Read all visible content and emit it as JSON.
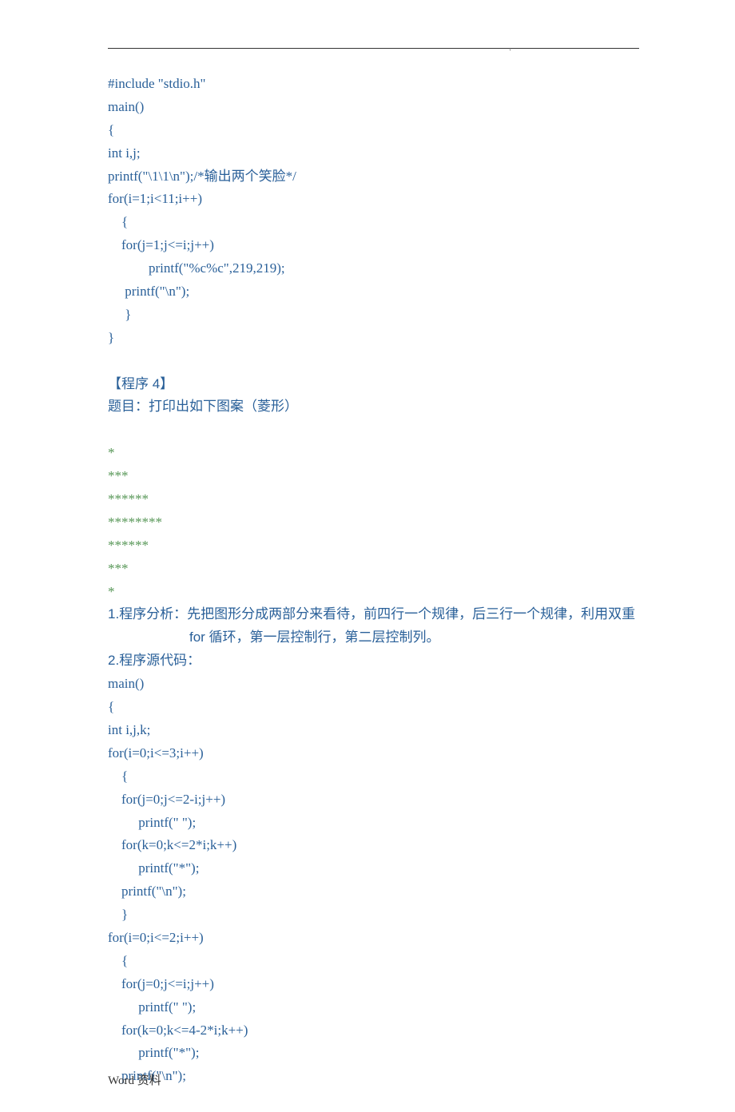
{
  "dot": ".",
  "code1": {
    "l1": "#include \"stdio.h\"",
    "l2": "main()",
    "l3": "{",
    "l4": "int i,j;",
    "l5": "printf(\"\\1\\1\\n\");/*输出两个笑脸*/",
    "l6": "for(i=1;i<11;i++)",
    "l7": "　{",
    "l8": "　for(j=1;j<=i;j++)",
    "l9": "　　　printf(\"%c%c\",219,219);",
    "l10": "　 printf(\"\\n\");",
    "l11": "　 }",
    "l12": "}"
  },
  "heading4": "【程序 4】",
  "title4": "题目：打印出如下图案（菱形）",
  "pattern": {
    "l1": "*",
    "l2": "***",
    "l3": "******",
    "l4": "********",
    "l5": "******",
    "l6": "***",
    "l7": "*"
  },
  "analysis": {
    "l1": "1.程序分析：先把图形分成两部分来看待，前四行一个规律，后三行一个规律，利用双重",
    "l2": "　　　　　　for 循环，第一层控制行，第二层控制列。",
    "l3": "2.程序源代码："
  },
  "code2": {
    "l1": "main()",
    "l2": "{",
    "l3": "int i,j,k;",
    "l4": "for(i=0;i<=3;i++)",
    "l5": "　{",
    "l6": "　for(j=0;j<=2-i;j++)",
    "l7": "　　 printf(\" \");",
    "l8": "　for(k=0;k<=2*i;k++)",
    "l9": "　　 printf(\"*\");",
    "l10": "　printf(\"\\n\");",
    "l11": "　}",
    "l12": "for(i=0;i<=2;i++)",
    "l13": "　{",
    "l14": "　for(j=0;j<=i;j++)",
    "l15": "　　 printf(\" \");",
    "l16": "　for(k=0;k<=4-2*i;k++)",
    "l17": "　　 printf(\"*\");",
    "l18": "　printf(\"\\n\");"
  },
  "footer": {
    "w": "Word ",
    "z": "资料"
  }
}
